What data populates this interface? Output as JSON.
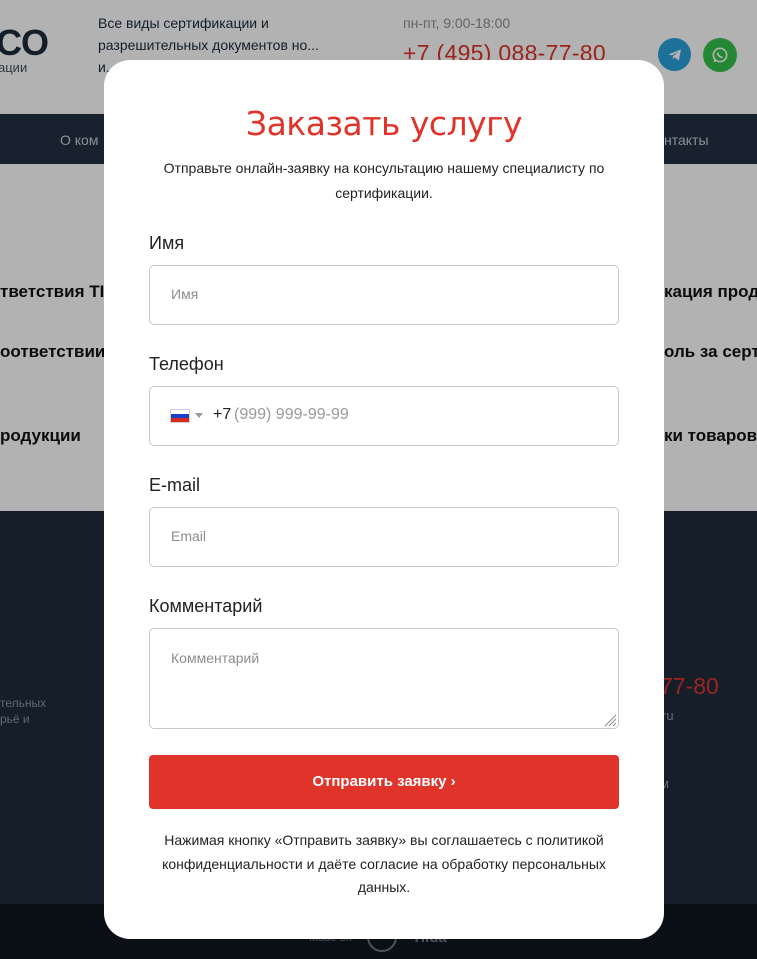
{
  "header": {
    "logo_text": "CO",
    "logo_subtext": "ации",
    "tagline": "Все виды сертификации и разрешительных документов но... и...",
    "hours": "пн-пт, 9:00-18:00",
    "phone": "+7 (495) 088-77-80",
    "messengers": [
      "telegram-icon",
      "whatsapp-icon"
    ]
  },
  "nav": {
    "items": [
      "О ком",
      "нтакты"
    ]
  },
  "services": {
    "items": [
      "тветствия ТІ",
      "оответствии",
      "родукции",
      "кация прод",
      "оль за серт",
      "ки товаров"
    ]
  },
  "footer": {
    "left_text": "тельных рьё и",
    "phone": "77-80",
    "email": "ru",
    "link": "м",
    "made_label": "Made on",
    "made_brand": "Tilda"
  },
  "modal": {
    "title": "Заказать услугу",
    "subtitle": "Отправьте онлайн-заявку на консультацию нашему специалисту по сертификации.",
    "fields": {
      "name": {
        "label": "Имя",
        "placeholder": "Имя"
      },
      "phone": {
        "label": "Телефон",
        "country_code": "+7",
        "placeholder": "(999) 999-99-99"
      },
      "email": {
        "label": "E-mail",
        "placeholder": "Email"
      },
      "comment": {
        "label": "Комментарий",
        "placeholder": "Комментарий"
      }
    },
    "submit_label": "Отправить заявку ›",
    "policy": "Нажимая кнопку «Отправить заявку» вы соглашаетесь с политикой конфиденциальности и даёте согласие на обработку персональных данных."
  },
  "colors": {
    "accent": "#e0342a",
    "nav_bg": "#223142",
    "footer_bg": "#1f2c3c",
    "overlay": "rgba(0,0,0,0.3)"
  }
}
